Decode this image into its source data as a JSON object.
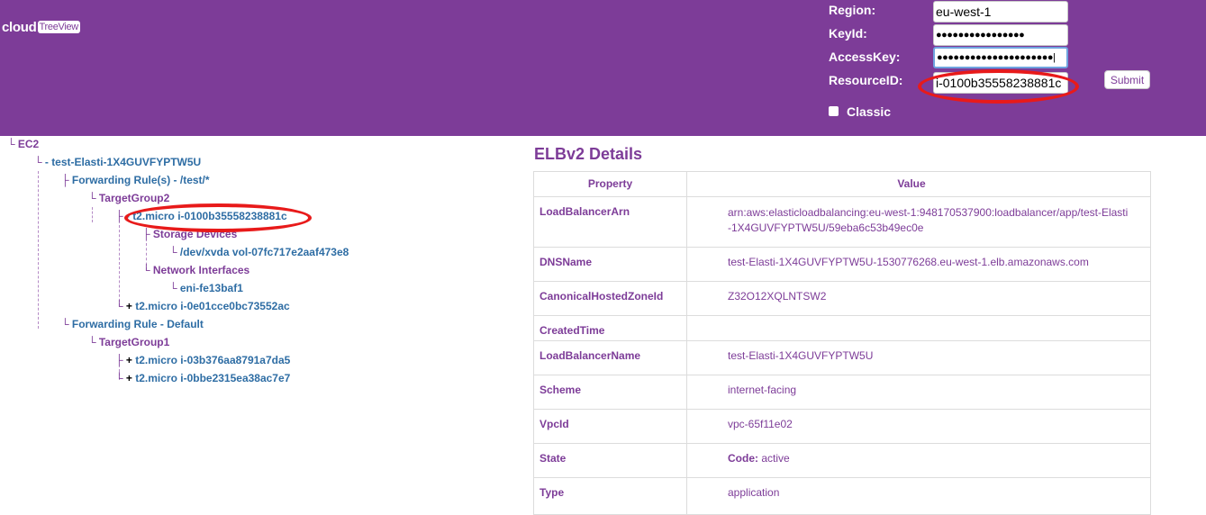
{
  "app": {
    "logo_main": "cloud",
    "logo_sub": "TreeView"
  },
  "form": {
    "region_label": "Region:",
    "region_value": "eu-west-1",
    "keyid_label": "KeyId:",
    "keyid_value": "●●●●●●●●●●●●●●●●",
    "accesskey_label": "AccessKey:",
    "accesskey_value": "●●●●●●●●●●●●●●●●●●●●●|",
    "resourceid_label": "ResourceID:",
    "resourceid_value": "i-0100b35558238881c",
    "submit_label": "Submit",
    "classic_label": "Classic"
  },
  "tree": {
    "root_connector": "└",
    "root_label": "EC2",
    "lb_connector": "└",
    "lb_label": "- test-Elasti-1X4GUVFYPTW5U",
    "rule1_connector": "├",
    "rule1_label": "Forwarding Rule(s) - /test/*",
    "tg2_connector": "└",
    "tg2_label": "TargetGroup2",
    "inst1_connector": "├",
    "inst1_label": "- t2.micro i-0100b35558238881c",
    "storage_connector": "├",
    "storage_label": "Storage Devices",
    "xvda_connector": "└",
    "xvda_label": "/dev/xvda vol-07fc717e2aaf473e8",
    "netif_connector": "└",
    "netif_label": "Network Interfaces",
    "eni_connector": "└",
    "eni_label": "eni-fe13baf1",
    "inst2_connector": "└",
    "inst2_sign": "+",
    "inst2_label": "t2.micro i-0e01cce0bc73552ac",
    "rule2_connector": "└",
    "rule2_label": "Forwarding Rule - Default",
    "tg1_connector": "└",
    "tg1_label": "TargetGroup1",
    "inst3_connector": "├",
    "inst3_sign": "+",
    "inst3_label": "t2.micro i-03b376aa8791a7da5",
    "inst4_connector": "└",
    "inst4_sign": "+",
    "inst4_label": "t2.micro i-0bbe2315ea38ac7e7"
  },
  "details": {
    "title": "ELBv2 Details",
    "col_property": "Property",
    "col_value": "Value",
    "rows": [
      {
        "property": "LoadBalancerArn",
        "value": "arn:aws:elasticloadbalancing:eu-west-1:948170537900:loadbalancer/app/test-Elasti-1X4GUVFYPTW5U/59eba6c53b49ec0e"
      },
      {
        "property": "DNSName",
        "value": "test-Elasti-1X4GUVFYPTW5U-1530776268.eu-west-1.elb.amazonaws.com"
      },
      {
        "property": "CanonicalHostedZoneId",
        "value": "Z32O12XQLNTSW2"
      },
      {
        "property": "CreatedTime",
        "value": ""
      },
      {
        "property": "LoadBalancerName",
        "value": "test-Elasti-1X4GUVFYPTW5U"
      },
      {
        "property": "Scheme",
        "value": "internet-facing"
      },
      {
        "property": "VpcId",
        "value": "vpc-65f11e02"
      },
      {
        "property": "State",
        "value_key": "Code:",
        "value": " active"
      },
      {
        "property": "Type",
        "value": "application"
      }
    ]
  },
  "colors": {
    "header_bg": "#7d3c98",
    "link_blue": "#2e6da4",
    "annotation_red": "#e81a1a"
  }
}
